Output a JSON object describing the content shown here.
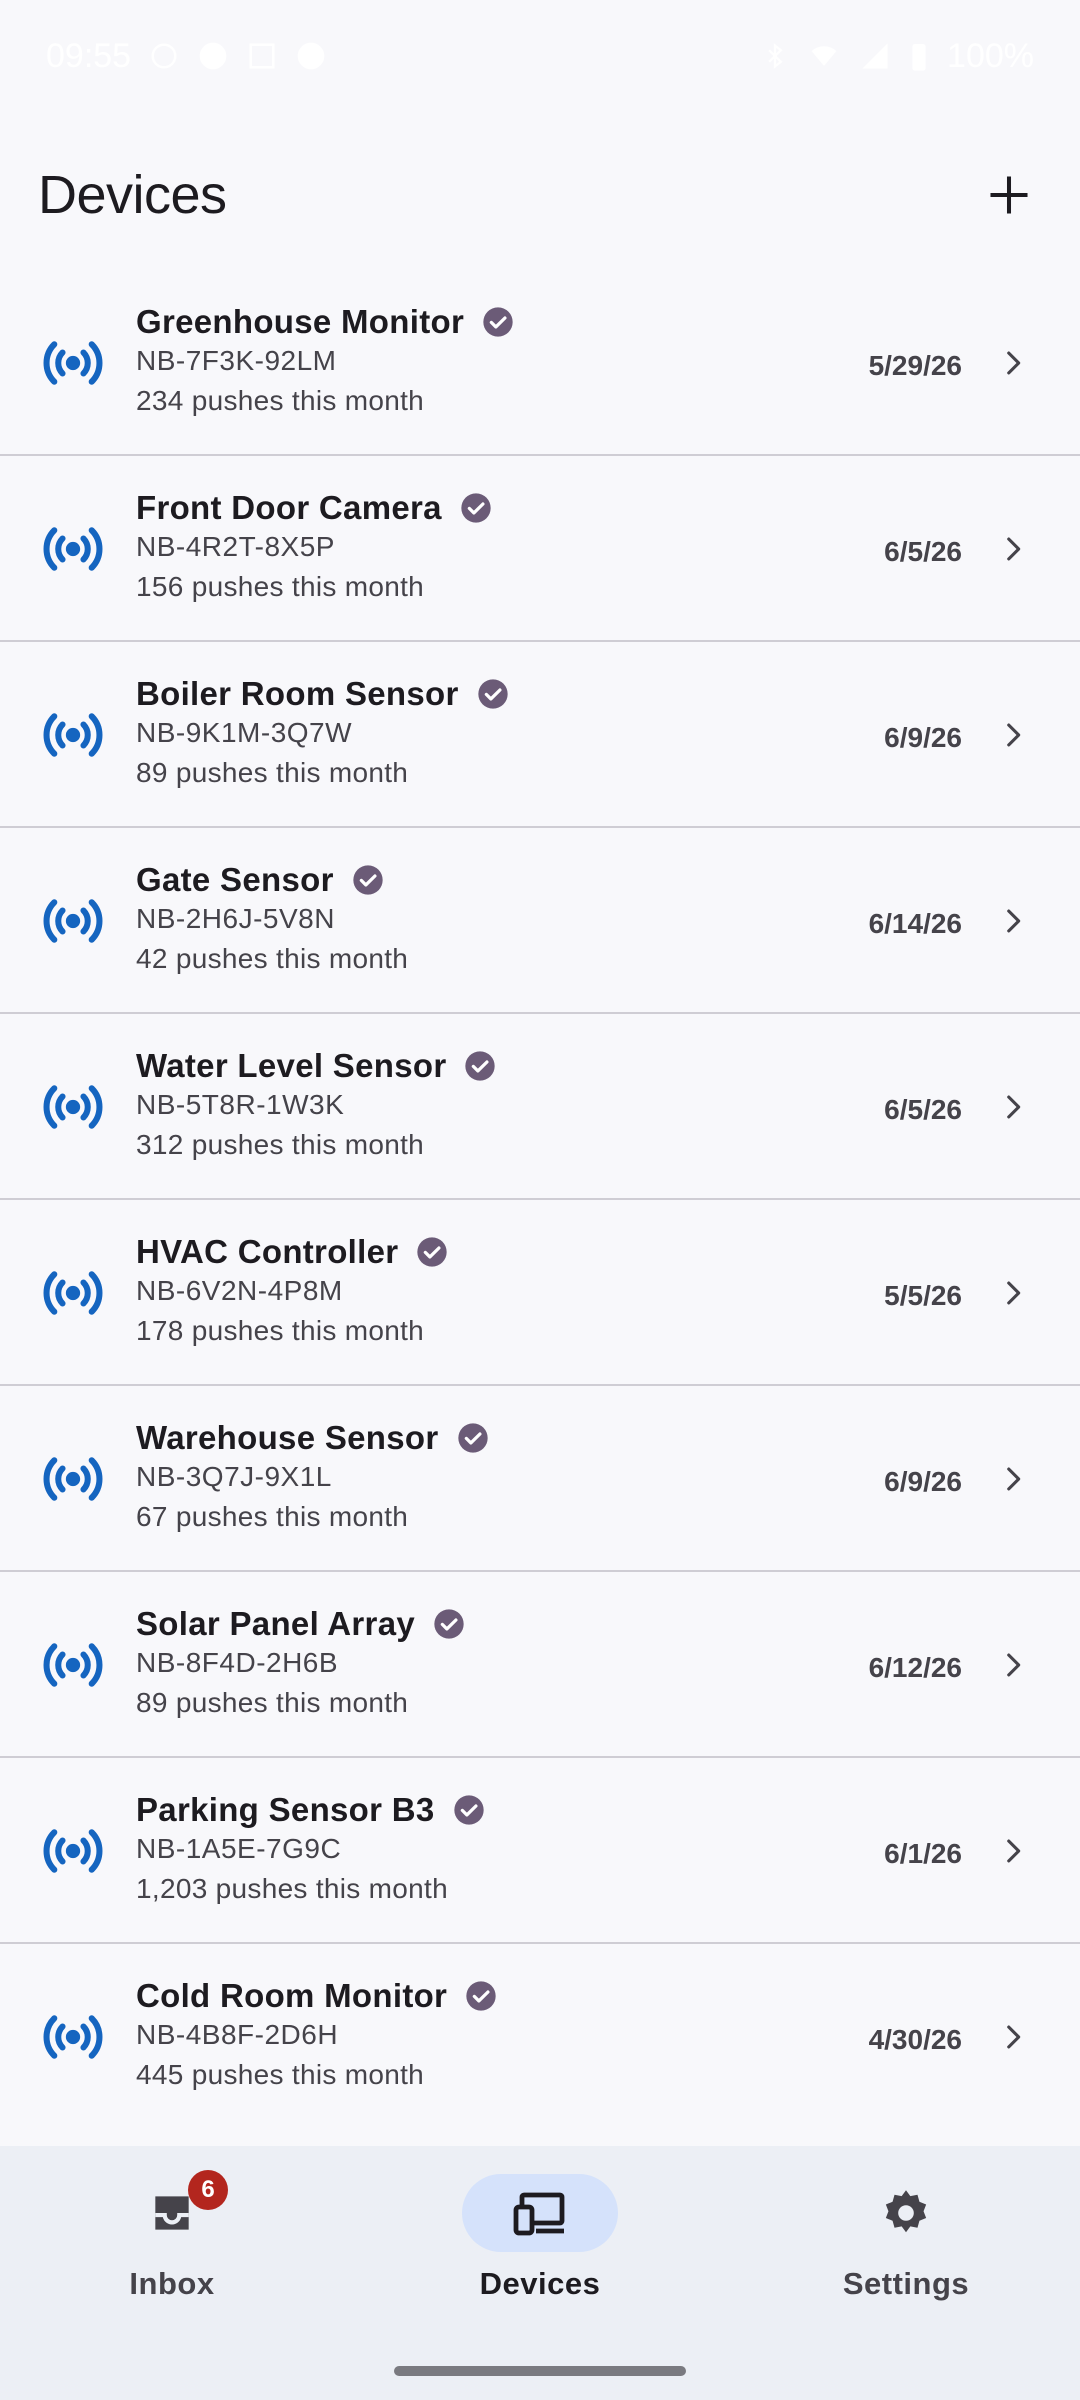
{
  "status_bar": {
    "time": "09:55",
    "battery": "100%"
  },
  "header": {
    "title": "Devices"
  },
  "devices": [
    {
      "name": "Greenhouse Monitor",
      "id": "NB-7F3K-92LM",
      "pushes": "234 pushes this month",
      "date": "5/29/26"
    },
    {
      "name": "Front Door Camera",
      "id": "NB-4R2T-8X5P",
      "pushes": "156 pushes this month",
      "date": "6/5/26"
    },
    {
      "name": "Boiler Room Sensor",
      "id": "NB-9K1M-3Q7W",
      "pushes": "89 pushes this month",
      "date": "6/9/26"
    },
    {
      "name": "Gate Sensor",
      "id": "NB-2H6J-5V8N",
      "pushes": "42 pushes this month",
      "date": "6/14/26"
    },
    {
      "name": "Water Level Sensor",
      "id": "NB-5T8R-1W3K",
      "pushes": "312 pushes this month",
      "date": "6/5/26"
    },
    {
      "name": "HVAC Controller",
      "id": "NB-6V2N-4P8M",
      "pushes": "178 pushes this month",
      "date": "5/5/26"
    },
    {
      "name": "Warehouse Sensor",
      "id": "NB-3Q7J-9X1L",
      "pushes": "67 pushes this month",
      "date": "6/9/26"
    },
    {
      "name": "Solar Panel Array",
      "id": "NB-8F4D-2H6B",
      "pushes": "89 pushes this month",
      "date": "6/12/26"
    },
    {
      "name": "Parking Sensor B3",
      "id": "NB-1A5E-7G9C",
      "pushes": "1,203 pushes this month",
      "date": "6/1/26"
    },
    {
      "name": "Cold Room Monitor",
      "id": "NB-4B8F-2D6H",
      "pushes": "445 pushes this month",
      "date": "4/30/26"
    }
  ],
  "nav": {
    "inbox": {
      "label": "Inbox",
      "badge": "6"
    },
    "devices": {
      "label": "Devices"
    },
    "settings": {
      "label": "Settings"
    }
  },
  "colors": {
    "accent": "#1565c0",
    "verified": "#6b5b77",
    "nav_active": "#d5e2fb",
    "badge": "#b3261e"
  },
  "icons": {
    "device": "signal-broadcast-icon",
    "verified": "verified-check-icon",
    "row_action": "chevron-right-icon",
    "add": "plus-icon"
  }
}
